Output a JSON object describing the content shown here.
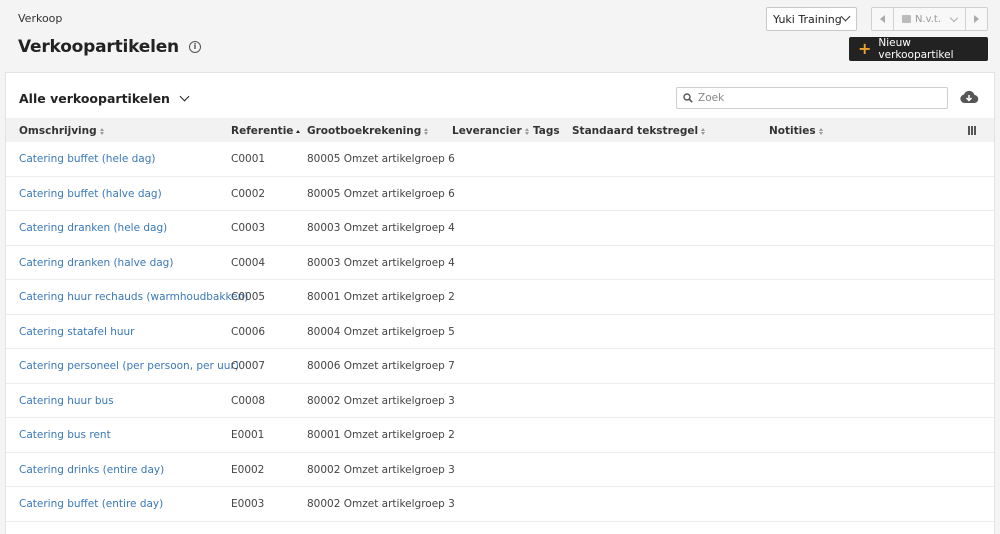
{
  "breadcrumb": "Verkoop",
  "page_title": "Verkoopartikelen",
  "company_select": "Yuki Training",
  "period": "N.v.t.",
  "new_button": "Nieuw verkoopartikel",
  "view_select": "Alle verkoopartikelen",
  "search": {
    "placeholder": "Zoek",
    "value": ""
  },
  "columns": [
    {
      "label": "Omschrijving",
      "sort": "none"
    },
    {
      "label": "Referentie",
      "sort": "asc"
    },
    {
      "label": "Grootboekrekening",
      "sort": "none"
    },
    {
      "label": "Leverancier",
      "sort": "none"
    },
    {
      "label": "Tags",
      "sort": ""
    },
    {
      "label": "Standaard tekstregel",
      "sort": "none"
    },
    {
      "label": "Notities",
      "sort": "none"
    }
  ],
  "rows": [
    {
      "description": "Catering buffet (hele dag)",
      "reference": "C0001",
      "ledger": "80005 Omzet artikelgroep 6"
    },
    {
      "description": "Catering buffet (halve dag)",
      "reference": "C0002",
      "ledger": "80005 Omzet artikelgroep 6"
    },
    {
      "description": "Catering dranken (hele dag)",
      "reference": "C0003",
      "ledger": "80003 Omzet artikelgroep 4"
    },
    {
      "description": "Catering dranken (halve dag)",
      "reference": "C0004",
      "ledger": "80003 Omzet artikelgroep 4"
    },
    {
      "description": "Catering huur rechauds (warmhoudbakken)",
      "reference": "C0005",
      "ledger": "80001 Omzet artikelgroep 2"
    },
    {
      "description": "Catering statafel huur",
      "reference": "C0006",
      "ledger": "80004 Omzet artikelgroep 5"
    },
    {
      "description": "Catering personeel (per persoon, per uur)",
      "reference": "C0007",
      "ledger": "80006 Omzet artikelgroep 7"
    },
    {
      "description": "Catering huur bus",
      "reference": "C0008",
      "ledger": "80002 Omzet artikelgroep 3"
    },
    {
      "description": "Catering bus rent",
      "reference": "E0001",
      "ledger": "80001 Omzet artikelgroep 2"
    },
    {
      "description": "Catering drinks (entire day)",
      "reference": "E0002",
      "ledger": "80002 Omzet artikelgroep 3"
    },
    {
      "description": "Catering buffet (entire day)",
      "reference": "E0003",
      "ledger": "80002 Omzet artikelgroep 3"
    }
  ],
  "colors": {
    "link": "#3a78b8",
    "button_bg": "#222222",
    "accent": "#f0a030"
  },
  "icons": [
    "info-icon",
    "chevron-down-icon",
    "chevron-left-icon",
    "calendar-icon",
    "chevron-right-icon",
    "plus-icon",
    "search-icon",
    "cloud-download-icon",
    "columns-icon"
  ]
}
